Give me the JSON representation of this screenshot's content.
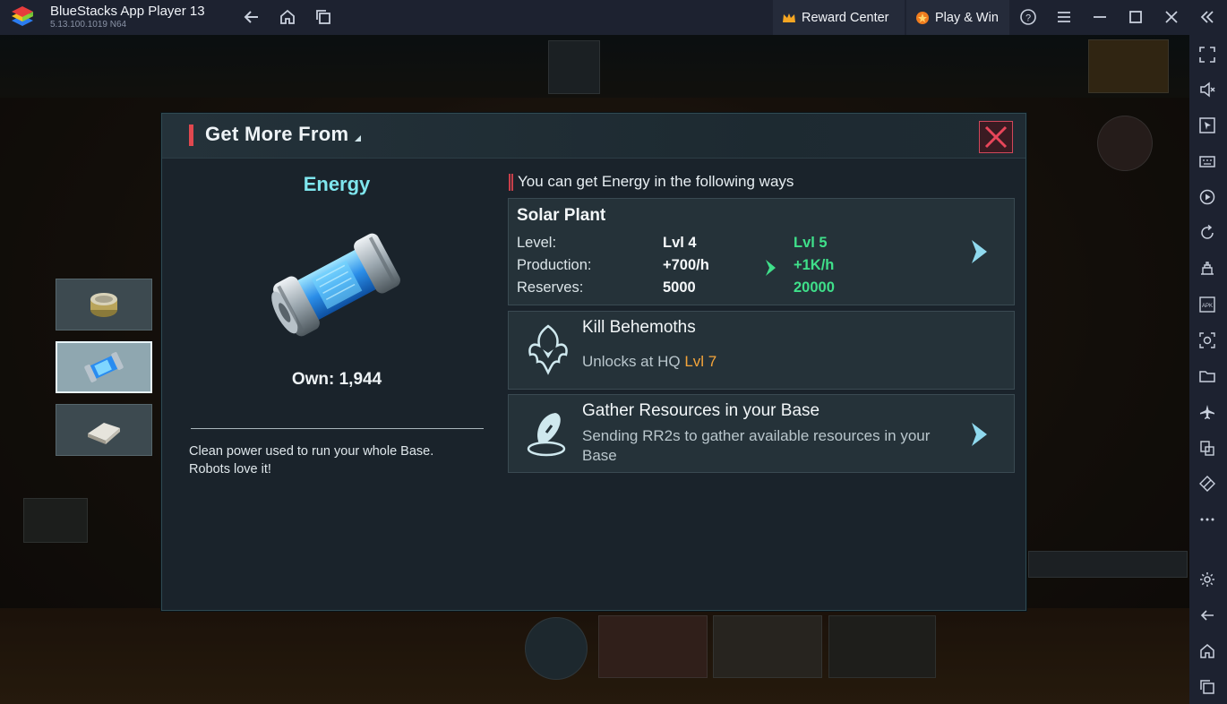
{
  "titlebar": {
    "app_name": "BlueStacks App Player 13",
    "version": "5.13.100.1019  N64",
    "reward_center": "Reward Center",
    "play_win": "Play & Win"
  },
  "dialog": {
    "title": "Get More From",
    "resource": {
      "name": "Energy",
      "own": "Own: 1,944",
      "description": "Clean power used to run your whole Base. Robots love it!"
    },
    "ways_header": "You can get Energy in the following ways",
    "solar_plant": {
      "title": "Solar Plant",
      "rows": [
        {
          "label": "Level:",
          "current": "Lvl 4",
          "next": "Lvl 5"
        },
        {
          "label": "Production:",
          "current": "+700/h",
          "next": "+1K/h"
        },
        {
          "label": "Reserves:",
          "current": "5000",
          "next": "20000"
        }
      ]
    },
    "kill_behemoths": {
      "title": "Kill Behemoths",
      "unlock_prefix": "Unlocks at HQ ",
      "unlock_level": "Lvl 7"
    },
    "gather": {
      "title": "Gather Resources in your Base",
      "description": "Sending RR2s to gather available resources in your Base"
    }
  },
  "colors": {
    "accent_cyan": "#7fe6ee",
    "green_next": "#3fe08a",
    "orange_level": "#f5a53a",
    "close_red": "#d1475a"
  }
}
